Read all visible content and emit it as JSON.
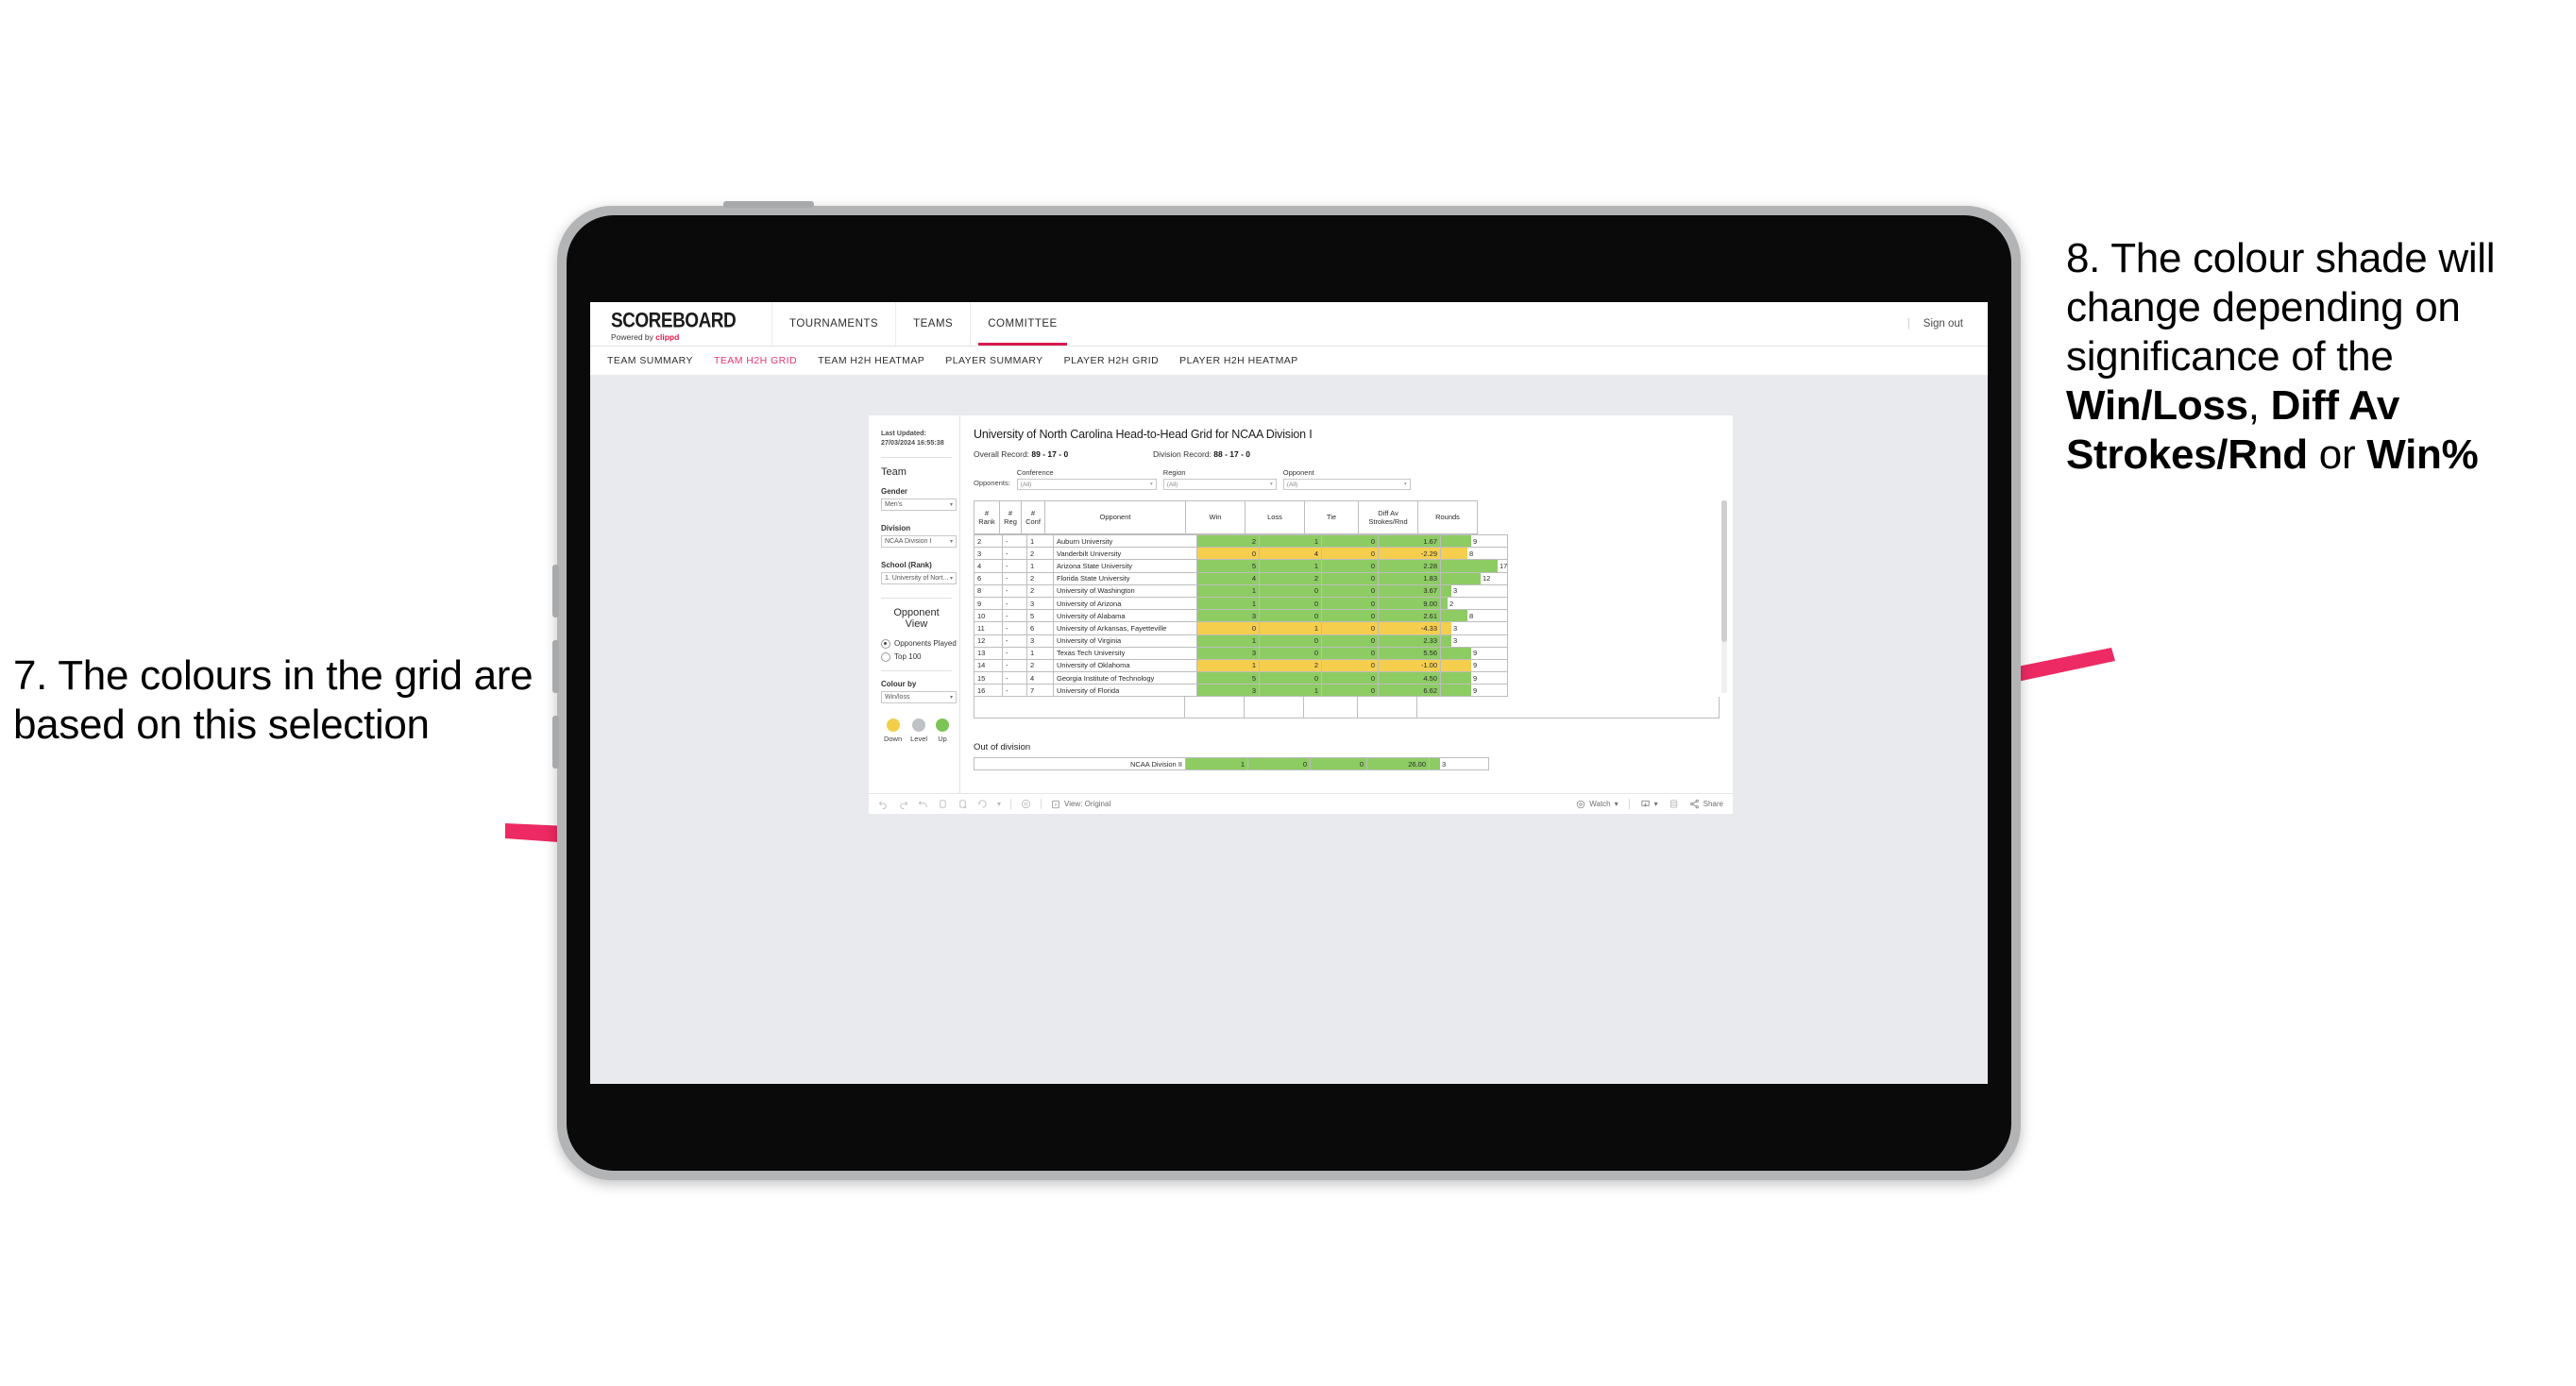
{
  "annotations": {
    "left": {
      "text": "7. The colours in the grid are based on this selection"
    },
    "right": {
      "p1": "8. The colour shade will change depending on significance of the ",
      "b1": "Win/Loss",
      "mid1": ", ",
      "b2": "Diff Av Strokes/Rnd",
      "mid2": " or ",
      "b3": "Win%"
    },
    "arrow_color": "#ED2A63"
  },
  "topnav": {
    "logo_main": "SCOREBOARD",
    "logo_sub_pre": "Powered by ",
    "logo_sub_brand": "clippd",
    "items": [
      {
        "label": "TOURNAMENTS",
        "active": false
      },
      {
        "label": "TEAMS",
        "active": false
      },
      {
        "label": "COMMITTEE",
        "active": true
      }
    ],
    "divider": "|",
    "signout": "Sign out"
  },
  "subnav": {
    "items": [
      {
        "label": "TEAM SUMMARY",
        "active": false
      },
      {
        "label": "TEAM H2H GRID",
        "active": true
      },
      {
        "label": "TEAM H2H HEATMAP",
        "active": false
      },
      {
        "label": "PLAYER SUMMARY",
        "active": false
      },
      {
        "label": "PLAYER H2H GRID",
        "active": false
      },
      {
        "label": "PLAYER H2H HEATMAP",
        "active": false
      }
    ],
    "active_color": "#e8356d"
  },
  "sidebar": {
    "last_updated": "Last Updated: 27/03/2024 16:55:38",
    "team_heading": "Team",
    "gender_label": "Gender",
    "gender_value": "Men's",
    "division_label": "Division",
    "division_value": "NCAA Division I",
    "school_label": "School (Rank)",
    "school_value": "1. University of Nort...",
    "opponent_view_heading": "Opponent View",
    "radio_opponents_played": "Opponents Played",
    "radio_top_100": "Top 100",
    "colour_by_label": "Colour by",
    "colour_by_value": "Win/loss",
    "legend": [
      {
        "name": "Down",
        "color": "#F2CE4B"
      },
      {
        "name": "Level",
        "color": "#BFC2C7"
      },
      {
        "name": "Up",
        "color": "#7CC455"
      }
    ]
  },
  "main": {
    "title": "University of North Carolina Head-to-Head Grid for NCAA Division I",
    "overall_record_label": "Overall Record: ",
    "overall_record_value": "89 - 17 - 0",
    "division_record_label": "Division Record: ",
    "division_record_value": "88 - 17 - 0",
    "opponents_label": "Opponents:",
    "filters": [
      {
        "label": "Conference",
        "value": "(All)"
      },
      {
        "label": "Region",
        "value": "(All)"
      },
      {
        "label": "Opponent",
        "value": "(All)"
      }
    ],
    "out_of_division_title": "Out of division"
  },
  "chart_data": {
    "type": "table",
    "title": "University of North Carolina Head-to-Head Grid for NCAA Division I",
    "columns": [
      "# Rank",
      "# Reg",
      "# Conf",
      "Opponent",
      "Win",
      "Loss",
      "Tie",
      "Diff Av Strokes/Rnd",
      "Rounds"
    ],
    "column_headers_multiline": [
      [
        "#",
        "Rank"
      ],
      [
        "#",
        "Reg"
      ],
      [
        "#",
        "Conf"
      ],
      [
        "Opponent"
      ],
      [
        "Win"
      ],
      [
        "Loss"
      ],
      [
        "Tie"
      ],
      [
        "Diff Av",
        "Strokes/Rnd"
      ],
      [
        "Rounds"
      ]
    ],
    "rounds_max": 17,
    "colour_legend": {
      "up": "#8DCC63",
      "down": "#F5CE4E",
      "level": "#BFC2C7"
    },
    "rows": [
      {
        "rank": "2",
        "reg": "-",
        "conf": "1",
        "opponent": "Auburn University",
        "win": "2",
        "loss": "1",
        "tie": "0",
        "diff": "1.67",
        "rounds": "9",
        "rounds_n": 9,
        "state": "g"
      },
      {
        "rank": "3",
        "reg": "-",
        "conf": "2",
        "opponent": "Vanderbilt University",
        "win": "0",
        "loss": "4",
        "tie": "0",
        "diff": "-2.29",
        "rounds": "8",
        "rounds_n": 8,
        "state": "y"
      },
      {
        "rank": "4",
        "reg": "-",
        "conf": "1",
        "opponent": "Arizona State University",
        "win": "5",
        "loss": "1",
        "tie": "0",
        "diff": "2.28",
        "rounds": "17",
        "rounds_n": 17,
        "state": "g"
      },
      {
        "rank": "6",
        "reg": "-",
        "conf": "2",
        "opponent": "Florida State University",
        "win": "4",
        "loss": "2",
        "tie": "0",
        "diff": "1.83",
        "rounds": "12",
        "rounds_n": 12,
        "state": "g"
      },
      {
        "rank": "8",
        "reg": "-",
        "conf": "2",
        "opponent": "University of Washington",
        "win": "1",
        "loss": "0",
        "tie": "0",
        "diff": "3.67",
        "rounds": "3",
        "rounds_n": 3,
        "state": "g"
      },
      {
        "rank": "9",
        "reg": "-",
        "conf": "3",
        "opponent": "University of Arizona",
        "win": "1",
        "loss": "0",
        "tie": "0",
        "diff": "9.00",
        "rounds": "2",
        "rounds_n": 2,
        "state": "g"
      },
      {
        "rank": "10",
        "reg": "-",
        "conf": "5",
        "opponent": "University of Alabama",
        "win": "3",
        "loss": "0",
        "tie": "0",
        "diff": "2.61",
        "rounds": "8",
        "rounds_n": 8,
        "state": "g"
      },
      {
        "rank": "11",
        "reg": "-",
        "conf": "6",
        "opponent": "University of Arkansas, Fayetteville",
        "win": "0",
        "loss": "1",
        "tie": "0",
        "diff": "-4.33",
        "rounds": "3",
        "rounds_n": 3,
        "state": "y"
      },
      {
        "rank": "12",
        "reg": "-",
        "conf": "3",
        "opponent": "University of Virginia",
        "win": "1",
        "loss": "0",
        "tie": "0",
        "diff": "2.33",
        "rounds": "3",
        "rounds_n": 3,
        "state": "g"
      },
      {
        "rank": "13",
        "reg": "-",
        "conf": "1",
        "opponent": "Texas Tech University",
        "win": "3",
        "loss": "0",
        "tie": "0",
        "diff": "5.56",
        "rounds": "9",
        "rounds_n": 9,
        "state": "g"
      },
      {
        "rank": "14",
        "reg": "-",
        "conf": "2",
        "opponent": "University of Oklahoma",
        "win": "1",
        "loss": "2",
        "tie": "0",
        "diff": "-1.00",
        "rounds": "9",
        "rounds_n": 9,
        "state": "y"
      },
      {
        "rank": "15",
        "reg": "-",
        "conf": "4",
        "opponent": "Georgia Institute of Technology",
        "win": "5",
        "loss": "0",
        "tie": "0",
        "diff": "4.50",
        "rounds": "9",
        "rounds_n": 9,
        "state": "g"
      },
      {
        "rank": "16",
        "reg": "-",
        "conf": "7",
        "opponent": "University of Florida",
        "win": "3",
        "loss": "1",
        "tie": "0",
        "diff": "6.62",
        "rounds": "9",
        "rounds_n": 9,
        "state": "g"
      }
    ],
    "out_of_division": [
      {
        "opponent": "NCAA Division II",
        "win": "1",
        "loss": "0",
        "tie": "0",
        "diff": "26.00",
        "rounds": "3",
        "rounds_n": 3,
        "state": "g"
      }
    ]
  },
  "toolbar": {
    "view_label": "View: Original",
    "watch_label": "Watch",
    "share_label": "Share"
  }
}
